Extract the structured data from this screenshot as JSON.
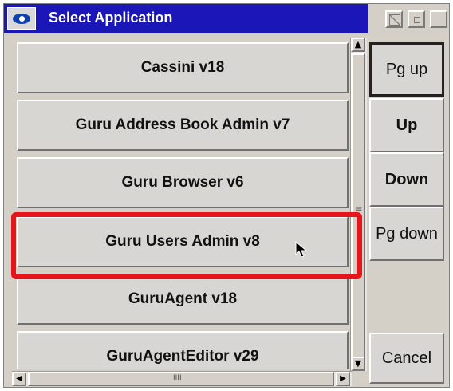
{
  "window": {
    "title": "Select Application"
  },
  "apps": [
    {
      "label": "Cassini v18"
    },
    {
      "label": "Guru Address Book Admin v7"
    },
    {
      "label": "Guru Browser v6"
    },
    {
      "label": "Guru Users Admin v8"
    },
    {
      "label": "GuruAgent v18"
    },
    {
      "label": "GuruAgentEditor v29"
    }
  ],
  "nav": {
    "pg_up": "Pg up",
    "up": "Up",
    "down": "Down",
    "pg_down": "Pg down",
    "cancel": "Cancel"
  },
  "icons": {
    "system": "eye-icon",
    "scroll_up": "arrow-up-icon",
    "scroll_down": "arrow-down-icon",
    "scroll_left": "arrow-left-icon",
    "scroll_right": "arrow-right-icon",
    "cursor": "mouse-pointer-icon"
  },
  "colors": {
    "titlebar": "#1a16b8",
    "highlight": "#e8141c"
  }
}
